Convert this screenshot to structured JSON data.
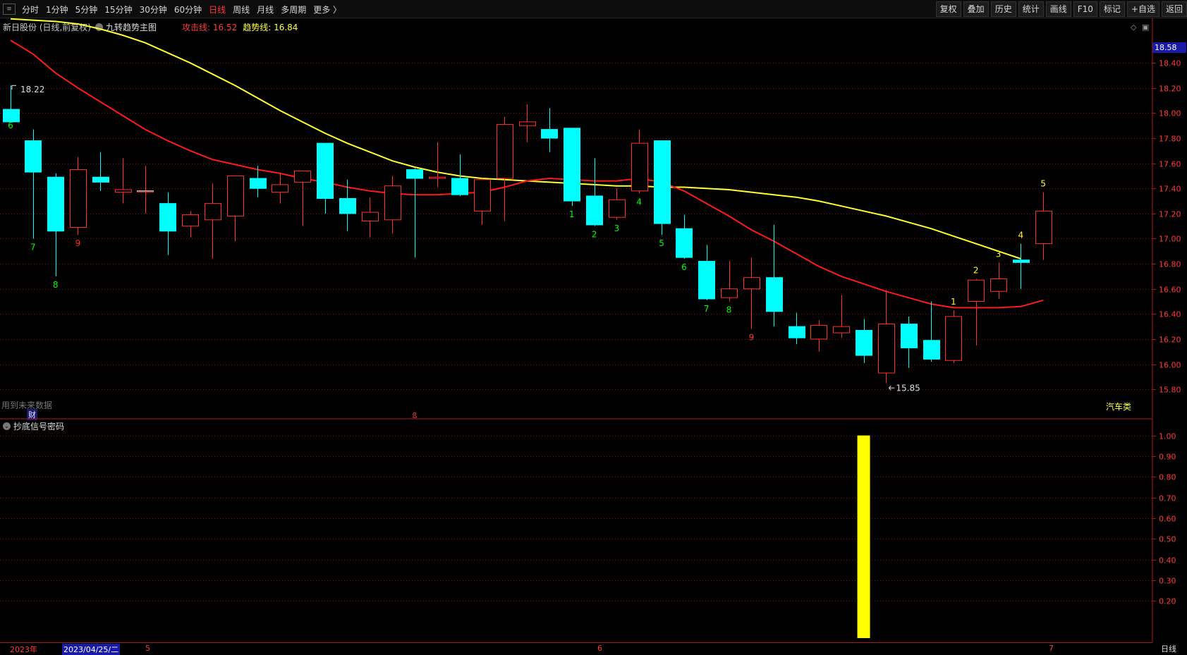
{
  "toolbar": {
    "menu_icon": "menu-toggle-icon",
    "periods": [
      "分时",
      "1分钟",
      "5分钟",
      "15分钟",
      "30分钟",
      "60分钟",
      "日线",
      "周线",
      "月线",
      "多周期",
      "更多 〉"
    ],
    "active_period": "日线",
    "actions": [
      "复权",
      "叠加",
      "历史",
      "统计",
      "画线",
      "F10",
      "标记",
      "+自选",
      "返回"
    ]
  },
  "main_panel": {
    "title": "新日股份 (日线,前复权)",
    "indicator_name": "九转趋势主图",
    "attack_line_label": "攻击线: 16.52",
    "trend_line_label": "趋势线: 16.84",
    "future_data_note": "用到未来数据",
    "finance_badge": "财",
    "dividend_marker": "ß",
    "sector_label": "汽车类",
    "current_price_tag": "18.58",
    "high_label": "18.22",
    "low_label": "15.85",
    "price_ticks": [
      "18.40",
      "18.20",
      "18.00",
      "17.80",
      "17.60",
      "17.40",
      "17.20",
      "17.00",
      "16.80",
      "16.60",
      "16.40",
      "16.20",
      "16.00",
      "15.80"
    ]
  },
  "sub_panel": {
    "indicator_name": "抄底信号密码",
    "value_ticks": [
      "1.00",
      "0.90",
      "0.80",
      "0.70",
      "0.60",
      "0.50",
      "0.40",
      "0.30",
      "0.20"
    ]
  },
  "date_axis": {
    "year_label": "2023年",
    "selected_date": "2023/04/25/二",
    "month_marks": [
      "5",
      "6",
      "7"
    ]
  },
  "period_label": "日线",
  "colors": {
    "up": "#ff3030",
    "down": "#00ffff",
    "attack_line": "#ff1a1a",
    "trend_line": "#ffff33",
    "grid": "#7a1414",
    "signal_bar": "#ffff00",
    "count_down": "#00ff00",
    "count_up_red": "#ff3030",
    "count_up_yellow": "#ffff33"
  },
  "chart_data": {
    "type": "candlestick",
    "candles": [
      {
        "o": 18.03,
        "h": 18.22,
        "l": 17.97,
        "c": 17.93
      },
      {
        "o": 17.78,
        "h": 17.87,
        "l": 17.0,
        "c": 17.53
      },
      {
        "o": 17.49,
        "h": 17.52,
        "l": 16.7,
        "c": 17.06
      },
      {
        "o": 17.09,
        "h": 17.65,
        "l": 17.03,
        "c": 17.55
      },
      {
        "o": 17.49,
        "h": 17.69,
        "l": 17.38,
        "c": 17.45
      },
      {
        "o": 17.37,
        "h": 17.64,
        "l": 17.28,
        "c": 17.39
      },
      {
        "o": 17.38,
        "h": 17.58,
        "l": 17.2,
        "c": 17.38
      },
      {
        "o": 17.28,
        "h": 17.37,
        "l": 16.87,
        "c": 17.06
      },
      {
        "o": 17.1,
        "h": 17.22,
        "l": 17.01,
        "c": 17.19
      },
      {
        "o": 17.15,
        "h": 17.44,
        "l": 16.84,
        "c": 17.28
      },
      {
        "o": 17.18,
        "h": 17.5,
        "l": 16.98,
        "c": 17.5
      },
      {
        "o": 17.48,
        "h": 17.58,
        "l": 17.33,
        "c": 17.4
      },
      {
        "o": 17.37,
        "h": 17.52,
        "l": 17.28,
        "c": 17.43
      },
      {
        "o": 17.45,
        "h": 17.54,
        "l": 17.1,
        "c": 17.54
      },
      {
        "o": 17.76,
        "h": 17.76,
        "l": 17.2,
        "c": 17.32
      },
      {
        "o": 17.32,
        "h": 17.47,
        "l": 17.06,
        "c": 17.2
      },
      {
        "o": 17.14,
        "h": 17.33,
        "l": 17.01,
        "c": 17.21
      },
      {
        "o": 17.15,
        "h": 17.5,
        "l": 17.04,
        "c": 17.42
      },
      {
        "o": 17.55,
        "h": 17.56,
        "l": 16.85,
        "c": 17.48
      },
      {
        "o": 17.48,
        "h": 17.77,
        "l": 17.41,
        "c": 17.49
      },
      {
        "o": 17.48,
        "h": 17.67,
        "l": 17.34,
        "c": 17.35
      },
      {
        "o": 17.22,
        "h": 17.48,
        "l": 17.11,
        "c": 17.47
      },
      {
        "o": 17.48,
        "h": 17.97,
        "l": 17.14,
        "c": 17.91
      },
      {
        "o": 17.9,
        "h": 18.07,
        "l": 17.77,
        "c": 17.93
      },
      {
        "o": 17.87,
        "h": 18.04,
        "l": 17.69,
        "c": 17.8
      },
      {
        "o": 17.88,
        "h": 17.88,
        "l": 17.26,
        "c": 17.3
      },
      {
        "o": 17.34,
        "h": 17.64,
        "l": 17.1,
        "c": 17.11
      },
      {
        "o": 17.17,
        "h": 17.4,
        "l": 17.15,
        "c": 17.31
      },
      {
        "o": 17.38,
        "h": 17.87,
        "l": 17.36,
        "c": 17.76
      },
      {
        "o": 17.78,
        "h": 17.78,
        "l": 17.03,
        "c": 17.12
      },
      {
        "o": 17.08,
        "h": 17.19,
        "l": 16.84,
        "c": 16.85
      },
      {
        "o": 16.82,
        "h": 16.95,
        "l": 16.51,
        "c": 16.52
      },
      {
        "o": 16.53,
        "h": 16.82,
        "l": 16.5,
        "c": 16.6
      },
      {
        "o": 16.6,
        "h": 16.85,
        "l": 16.28,
        "c": 16.69
      },
      {
        "o": 16.69,
        "h": 17.11,
        "l": 16.3,
        "c": 16.42
      },
      {
        "o": 16.3,
        "h": 16.41,
        "l": 16.16,
        "c": 16.21
      },
      {
        "o": 16.2,
        "h": 16.35,
        "l": 16.1,
        "c": 16.31
      },
      {
        "o": 16.25,
        "h": 16.55,
        "l": 16.21,
        "c": 16.3
      },
      {
        "o": 16.27,
        "h": 16.36,
        "l": 16.01,
        "c": 16.07
      },
      {
        "o": 15.93,
        "h": 16.59,
        "l": 15.85,
        "c": 16.32
      },
      {
        "o": 16.32,
        "h": 16.38,
        "l": 15.97,
        "c": 16.13
      },
      {
        "o": 16.19,
        "h": 16.5,
        "l": 16.02,
        "c": 16.04
      },
      {
        "o": 16.03,
        "h": 16.43,
        "l": 16.01,
        "c": 16.38
      },
      {
        "o": 16.5,
        "h": 16.68,
        "l": 16.15,
        "c": 16.67
      },
      {
        "o": 16.58,
        "h": 16.81,
        "l": 16.52,
        "c": 16.68
      },
      {
        "o": 16.83,
        "h": 16.96,
        "l": 16.6,
        "c": 16.81
      },
      {
        "o": 16.96,
        "h": 17.37,
        "l": 16.83,
        "c": 17.22
      }
    ],
    "attack_line": [
      18.58,
      18.47,
      18.32,
      18.2,
      18.09,
      17.98,
      17.87,
      17.78,
      17.7,
      17.63,
      17.59,
      17.55,
      17.52,
      17.48,
      17.45,
      17.41,
      17.38,
      17.36,
      17.35,
      17.35,
      17.36,
      17.37,
      17.41,
      17.46,
      17.48,
      17.47,
      17.46,
      17.46,
      17.48,
      17.45,
      17.38,
      17.28,
      17.18,
      17.07,
      16.98,
      16.88,
      16.78,
      16.7,
      16.64,
      16.58,
      16.53,
      16.48,
      16.45,
      16.45,
      16.45,
      16.46,
      16.51
    ],
    "trend_line": [
      18.75,
      18.74,
      18.73,
      18.71,
      18.67,
      18.62,
      18.56,
      18.48,
      18.4,
      18.31,
      18.22,
      18.12,
      18.02,
      17.93,
      17.84,
      17.76,
      17.69,
      17.62,
      17.57,
      17.53,
      17.5,
      17.48,
      17.47,
      17.46,
      17.45,
      17.44,
      17.43,
      17.42,
      17.42,
      17.41,
      17.41,
      17.4,
      17.39,
      17.37,
      17.35,
      17.33,
      17.3,
      17.26,
      17.22,
      17.18,
      17.13,
      17.08,
      17.02,
      16.96,
      16.9,
      16.84
    ],
    "nine_turn_labels": [
      {
        "i": 0,
        "text": "6",
        "color": "down",
        "pos": "below"
      },
      {
        "i": 1,
        "text": "7",
        "color": "down",
        "pos": "below"
      },
      {
        "i": 2,
        "text": "8",
        "color": "down",
        "pos": "below"
      },
      {
        "i": 3,
        "text": "9",
        "color": "up",
        "pos": "below"
      },
      {
        "i": 25,
        "text": "1",
        "color": "down",
        "pos": "below"
      },
      {
        "i": 26,
        "text": "2",
        "color": "down",
        "pos": "below"
      },
      {
        "i": 27,
        "text": "3",
        "color": "down",
        "pos": "below"
      },
      {
        "i": 28,
        "text": "4",
        "color": "down",
        "pos": "below"
      },
      {
        "i": 29,
        "text": "5",
        "color": "down",
        "pos": "below"
      },
      {
        "i": 30,
        "text": "6",
        "color": "down",
        "pos": "below"
      },
      {
        "i": 31,
        "text": "7",
        "color": "down",
        "pos": "below"
      },
      {
        "i": 32,
        "text": "8",
        "color": "down",
        "pos": "below"
      },
      {
        "i": 33,
        "text": "9",
        "color": "up",
        "pos": "below"
      },
      {
        "i": 42,
        "text": "1",
        "color": "yellow",
        "pos": "above"
      },
      {
        "i": 43,
        "text": "2",
        "color": "yellow",
        "pos": "above"
      },
      {
        "i": 44,
        "text": "3",
        "color": "yellow",
        "pos": "above"
      },
      {
        "i": 45,
        "text": "4",
        "color": "yellow",
        "pos": "above"
      },
      {
        "i": 46,
        "text": "5",
        "color": "yellow",
        "pos": "above"
      }
    ],
    "signal": {
      "index": 38,
      "value": 1.0
    },
    "price_range": [
      15.7,
      18.62
    ],
    "signal_range": [
      0,
      1.06
    ]
  }
}
